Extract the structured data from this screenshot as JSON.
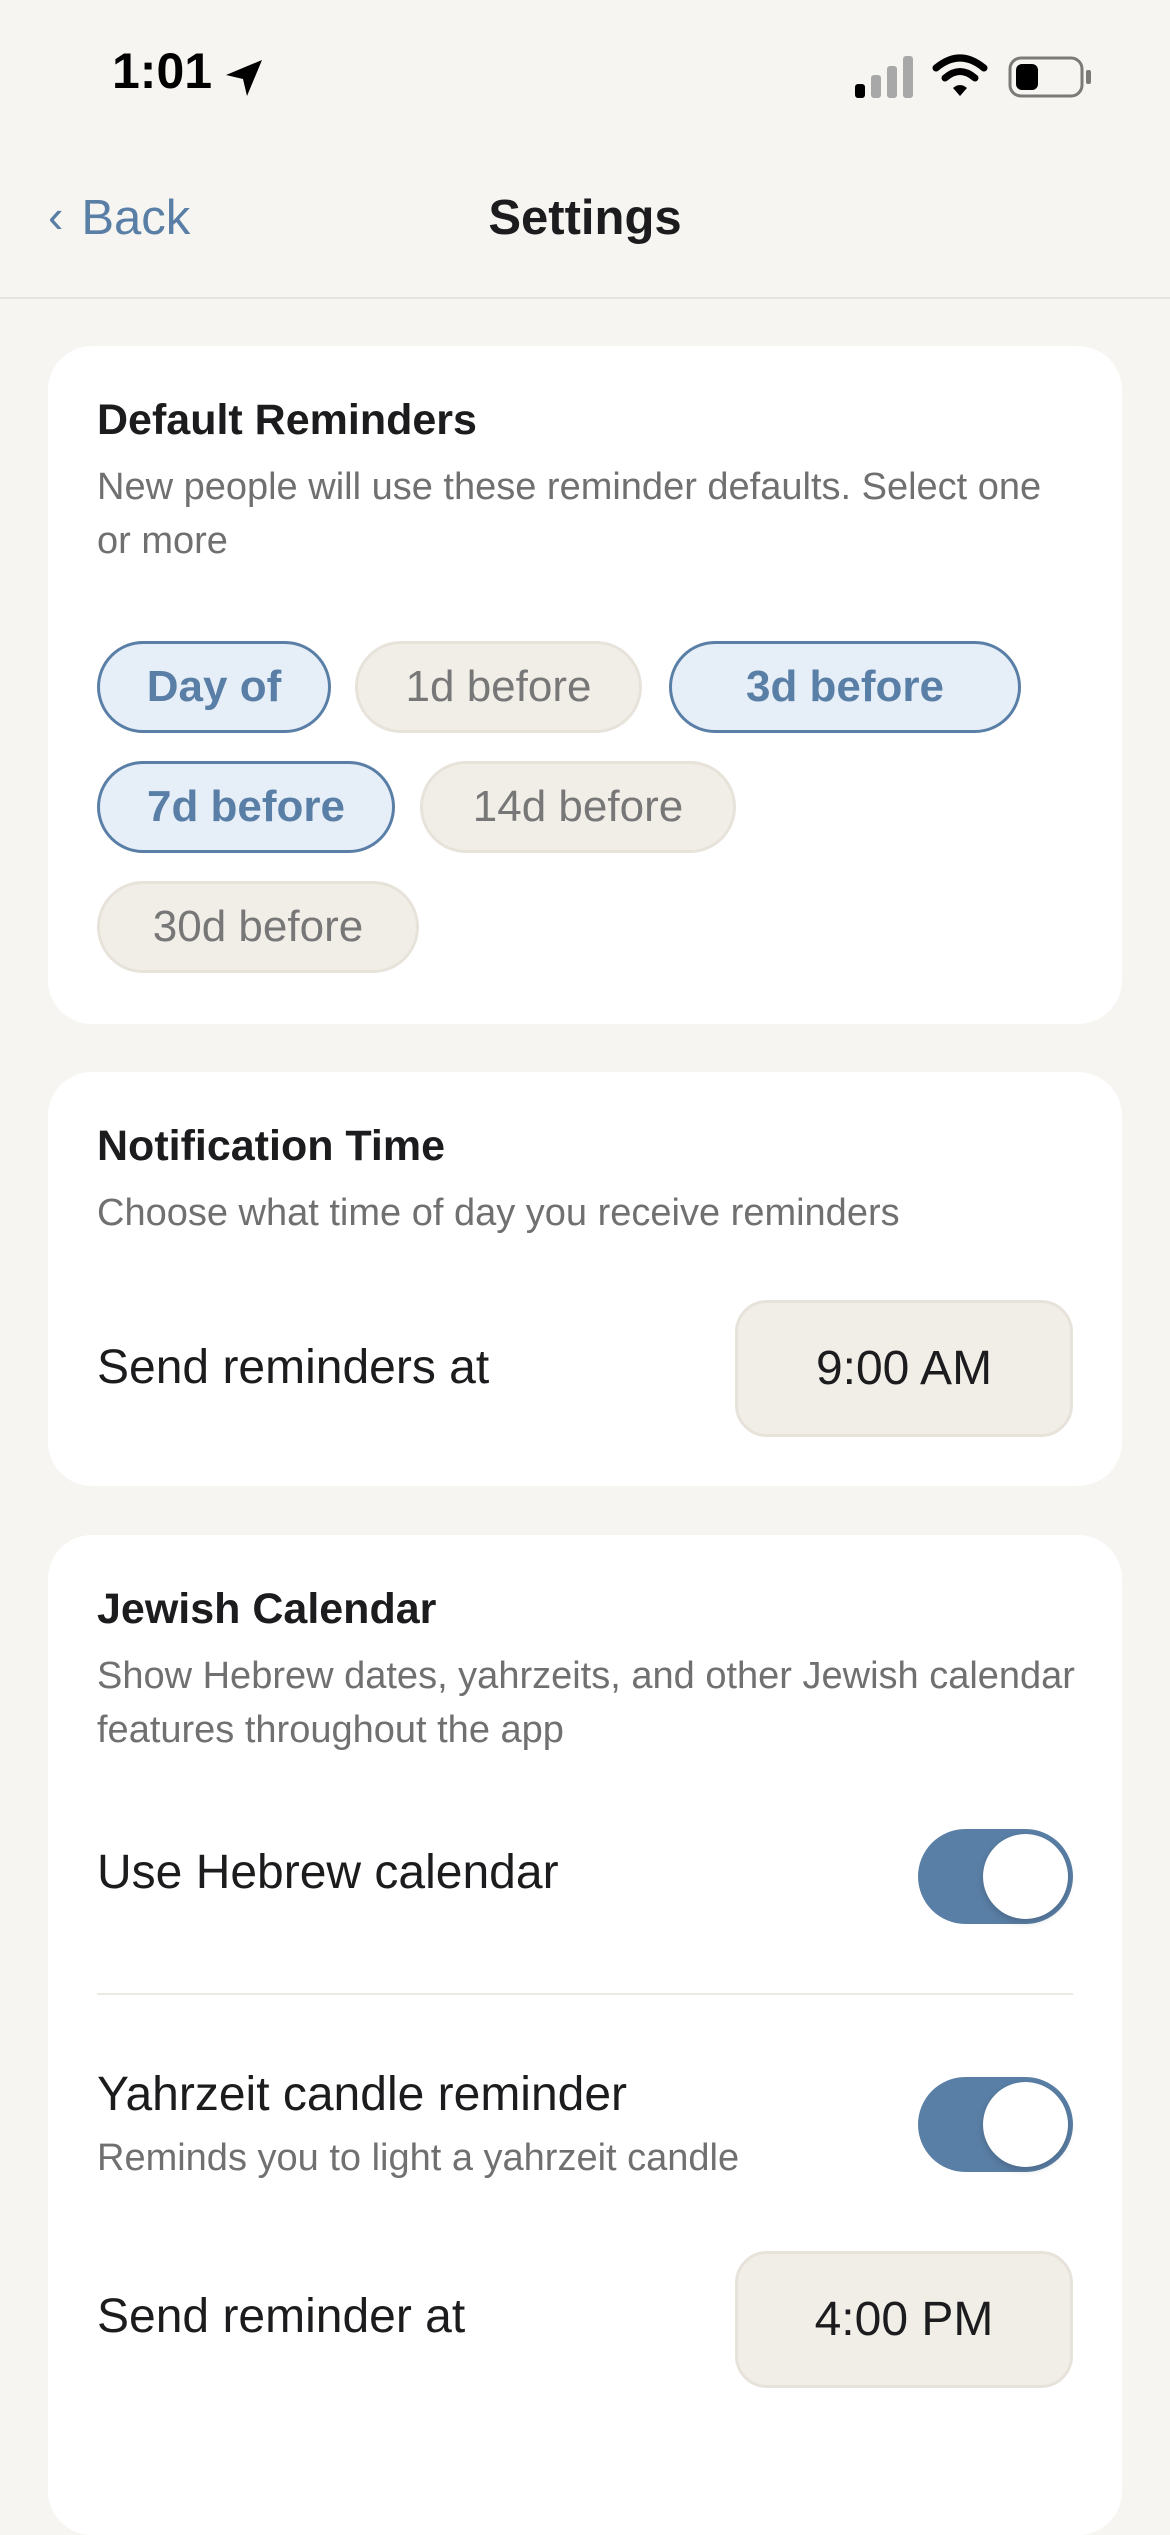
{
  "status_bar": {
    "time": "1:01",
    "icons": [
      "location-arrow-icon",
      "cellular-signal-icon",
      "wifi-icon",
      "battery-icon"
    ]
  },
  "nav": {
    "back_label": "Back",
    "back_icon": "chevron-left-icon",
    "title": "Settings"
  },
  "default_reminders": {
    "title": "Default Reminders",
    "description": "New people will use these reminder defaults. Select one or more",
    "options": [
      {
        "label": "Day of",
        "selected": true
      },
      {
        "label": "1d before",
        "selected": false
      },
      {
        "label": "3d before",
        "selected": true
      },
      {
        "label": "7d before",
        "selected": true
      },
      {
        "label": "14d before",
        "selected": false
      },
      {
        "label": "30d before",
        "selected": false
      }
    ]
  },
  "notification_time": {
    "title": "Notification Time",
    "description": "Choose what time of day you receive reminders",
    "row_label": "Send reminders at",
    "value": "9:00 AM"
  },
  "jewish_calendar": {
    "title": "Jewish Calendar",
    "description": "Show Hebrew dates, yahrzeits, and other Jewish calendar features throughout the app",
    "hebrew_calendar": {
      "label": "Use Hebrew calendar",
      "enabled": true
    },
    "yahrzeit_candle": {
      "label": "Yahrzeit candle reminder",
      "sublabel": "Reminds you to light a yahrzeit candle",
      "enabled": true
    },
    "reminder_time": {
      "label": "Send reminder at",
      "value": "4:00 PM"
    }
  },
  "colors": {
    "accent": "#5a7fa6",
    "chip_selected_bg": "#e6eef8",
    "chip_unselected_bg": "#f1eee8",
    "background": "#f6f5f1",
    "card": "#ffffff"
  }
}
